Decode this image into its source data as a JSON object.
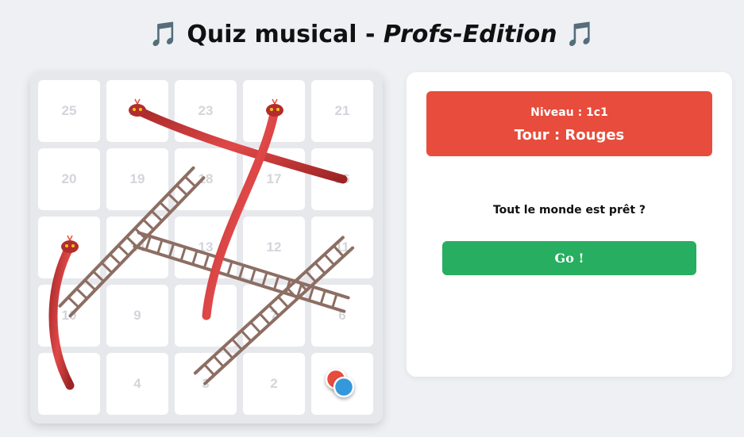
{
  "header": {
    "icon_left": "🎵",
    "icon_right": "🎵",
    "title_main": "Quiz musical - ",
    "title_edition": "Profs-Edition"
  },
  "board": {
    "rows": [
      [
        "25",
        "24",
        "23",
        "22",
        "21"
      ],
      [
        "20",
        "19",
        "18",
        "17",
        "16"
      ],
      [
        "15",
        "14",
        "13",
        "12",
        "11"
      ],
      [
        "10",
        "9",
        "8",
        "7",
        "6"
      ],
      [
        "5",
        "4",
        "3",
        "2",
        "1"
      ]
    ],
    "snakes": [
      {
        "from": 24,
        "to": 16
      },
      {
        "from": 22,
        "to": 8
      },
      {
        "from": 15,
        "to": 5
      }
    ],
    "ladders": [
      {
        "from": 10,
        "to": 18
      },
      {
        "from": 14,
        "to": 6
      },
      {
        "from": 3,
        "to": 11
      }
    ],
    "pawns": [
      {
        "team": "Rouges",
        "color": "#e74c3c",
        "cell": 1
      },
      {
        "team": "Bleus",
        "color": "#3498db",
        "cell": 1
      }
    ],
    "snake_color": "#c0392b",
    "ladder_color": "#8d6e63"
  },
  "panel": {
    "level": "Niveau : 1c1",
    "turn": "Tour : Rouges",
    "turn_color": "#e74c3c",
    "ready_text": "Tout le monde est prêt ?",
    "go_label": "Go !",
    "go_color": "#27ae60"
  }
}
